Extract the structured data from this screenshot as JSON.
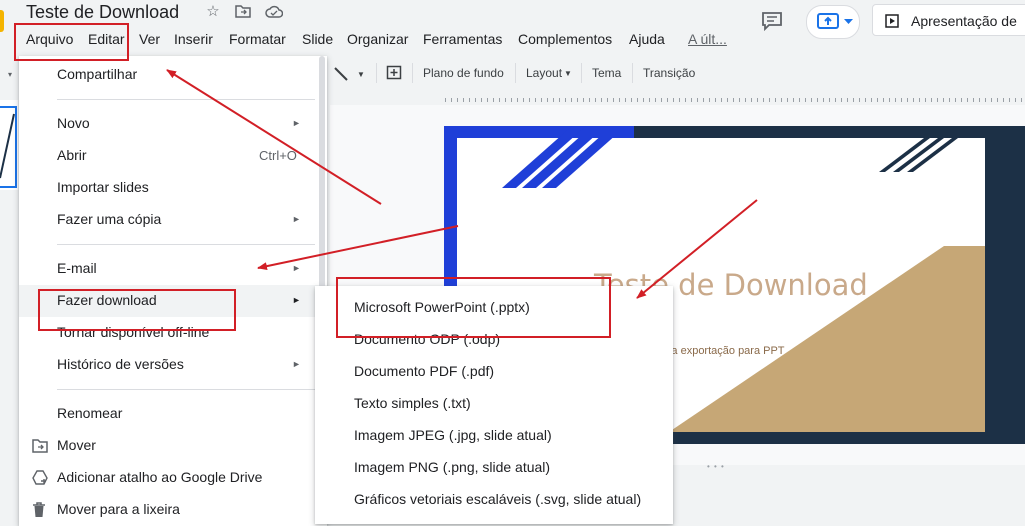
{
  "document": {
    "title": "Teste de Download"
  },
  "menubar": {
    "items": [
      "Arquivo",
      "Editar",
      "Ver",
      "Inserir",
      "Formatar",
      "Slide",
      "Organizar",
      "Ferramentas",
      "Complementos",
      "Ajuda"
    ],
    "last_edit": "A últ..."
  },
  "header": {
    "present_label": "Apresentação de"
  },
  "toolbar": {
    "background": "Plano de fundo",
    "layout": "Layout",
    "theme": "Tema",
    "transition": "Transição"
  },
  "file_menu": {
    "items": [
      {
        "label": "Compartilhar"
      },
      {
        "label": "Novo"
      },
      {
        "label": "Abrir",
        "shortcut": "Ctrl+O"
      },
      {
        "label": "Importar slides"
      },
      {
        "label": "Fazer uma cópia"
      },
      {
        "label": "E-mail"
      },
      {
        "label": "Fazer download"
      },
      {
        "label": "Tornar disponível off-line"
      },
      {
        "label": "Histórico de versões"
      },
      {
        "label": "Renomear"
      },
      {
        "label": "Mover"
      },
      {
        "label": "Adicionar atalho ao Google Drive"
      },
      {
        "label": "Mover para a lixeira"
      }
    ]
  },
  "download_submenu": {
    "items": [
      "Microsoft PowerPoint (.pptx)",
      "Documento ODP (.odp)",
      "Documento PDF (.pdf)",
      "Texto simples (.txt)",
      "Imagem JPEG (.jpg, slide atual)",
      "Imagem PNG (.png, slide atual)",
      "Gráficos vetoriais escaláveis (.svg, slide atual)"
    ]
  },
  "slide": {
    "title": "Teste de Download",
    "subtitle": "ndo a exportação para PPT"
  },
  "colors": {
    "annotation": "#d21f26",
    "accent": "#1a73e8",
    "slide_frame": "#1c3046",
    "slide_stripe": "#1f3fd8",
    "slide_gold": "#c6a776"
  }
}
